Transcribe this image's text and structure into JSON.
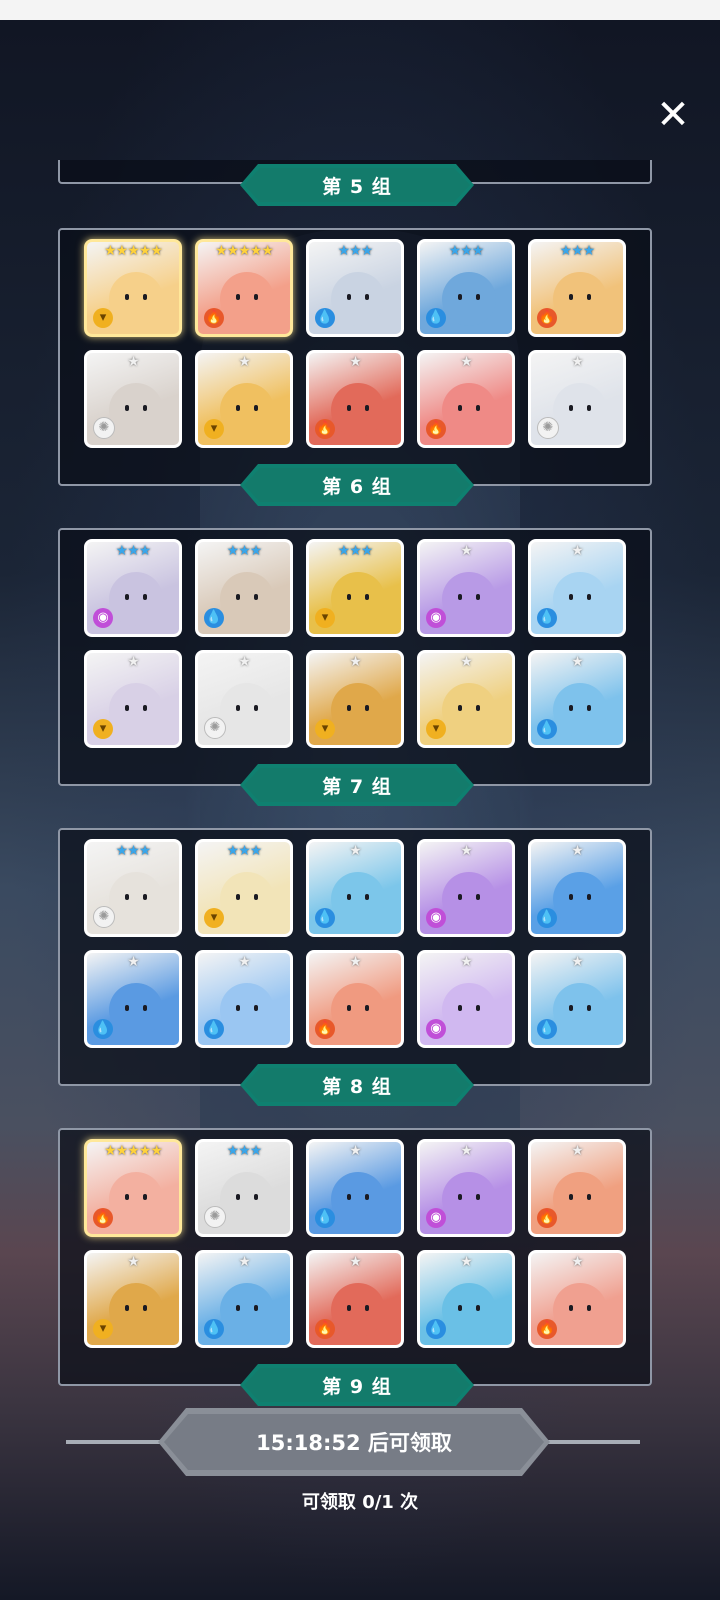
{
  "close_icon": "✕",
  "groups": [
    {
      "banner": "第 5 组",
      "heroes": [
        {
          "stars": "★★★★★",
          "star_color": "gold",
          "element": "wind",
          "bg": "#f6d08a"
        },
        {
          "stars": "★★★★★",
          "star_color": "gold",
          "element": "fire",
          "bg": "#f3a08a"
        },
        {
          "stars": "★★★",
          "star_color": "blue",
          "element": "water",
          "bg": "#c9d3e2"
        },
        {
          "stars": "★★★",
          "star_color": "blue",
          "element": "water",
          "bg": "#6fa8dc"
        },
        {
          "stars": "★★★",
          "star_color": "blue",
          "element": "fire",
          "bg": "#f1c27a"
        },
        {
          "stars": "★",
          "star_color": "gray",
          "element": "light",
          "bg": "#d9d2cc"
        },
        {
          "stars": "★",
          "star_color": "gray",
          "element": "wind",
          "bg": "#f0c060"
        },
        {
          "stars": "★",
          "star_color": "gray",
          "element": "fire",
          "bg": "#e26a5a"
        },
        {
          "stars": "★",
          "star_color": "gray",
          "element": "fire",
          "bg": "#ef8a86"
        },
        {
          "stars": "★",
          "star_color": "gray",
          "element": "light",
          "bg": "#dfe3ea"
        }
      ]
    },
    {
      "banner": "第 6 组",
      "heroes": [
        {
          "stars": "★★★",
          "star_color": "blue",
          "element": "dark",
          "bg": "#c9c3e0"
        },
        {
          "stars": "★★★",
          "star_color": "blue",
          "element": "water",
          "bg": "#d9c9b8"
        },
        {
          "stars": "★★★",
          "star_color": "blue",
          "element": "wind",
          "bg": "#e8c04a"
        },
        {
          "stars": "★",
          "star_color": "gray",
          "element": "dark",
          "bg": "#b89ae6"
        },
        {
          "stars": "★",
          "star_color": "gray",
          "element": "water",
          "bg": "#a8d4f2"
        },
        {
          "stars": "★",
          "star_color": "gray",
          "element": "wind",
          "bg": "#d8d0e6"
        },
        {
          "stars": "★",
          "star_color": "gray",
          "element": "light",
          "bg": "#e6e6e6"
        },
        {
          "stars": "★",
          "star_color": "gray",
          "element": "wind",
          "bg": "#e0a84a"
        },
        {
          "stars": "★",
          "star_color": "gray",
          "element": "wind",
          "bg": "#efd080"
        },
        {
          "stars": "★",
          "star_color": "gray",
          "element": "water",
          "bg": "#7ec2ec"
        }
      ]
    },
    {
      "banner": "第 7 组",
      "heroes": [
        {
          "stars": "★★★",
          "star_color": "blue",
          "element": "light",
          "bg": "#e6e2dc"
        },
        {
          "stars": "★★★",
          "star_color": "blue",
          "element": "wind",
          "bg": "#f2e4b8"
        },
        {
          "stars": "★",
          "star_color": "gray",
          "element": "water",
          "bg": "#7cc6ea"
        },
        {
          "stars": "★",
          "star_color": "gray",
          "element": "dark",
          "bg": "#b690e6"
        },
        {
          "stars": "★",
          "star_color": "gray",
          "element": "water",
          "bg": "#5aa0e6"
        },
        {
          "stars": "★",
          "star_color": "gray",
          "element": "water",
          "bg": "#5a9ae2"
        },
        {
          "stars": "★",
          "star_color": "gray",
          "element": "water",
          "bg": "#9ac6f2"
        },
        {
          "stars": "★",
          "star_color": "gray",
          "element": "fire",
          "bg": "#f09a80"
        },
        {
          "stars": "★",
          "star_color": "gray",
          "element": "dark",
          "bg": "#d0b8f0"
        },
        {
          "stars": "★",
          "star_color": "gray",
          "element": "water",
          "bg": "#7ec2ec"
        }
      ]
    },
    {
      "banner": "第 8 组",
      "heroes": [
        {
          "stars": "★★★★★",
          "star_color": "gold",
          "element": "fire",
          "bg": "#f3b0a0"
        },
        {
          "stars": "★★★",
          "star_color": "blue",
          "element": "light",
          "bg": "#dcdcdc"
        },
        {
          "stars": "★",
          "star_color": "gray",
          "element": "water",
          "bg": "#5a9ae2"
        },
        {
          "stars": "★",
          "star_color": "gray",
          "element": "dark",
          "bg": "#b690e6"
        },
        {
          "stars": "★",
          "star_color": "gray",
          "element": "fire",
          "bg": "#f0a080"
        },
        {
          "stars": "★",
          "star_color": "gray",
          "element": "wind",
          "bg": "#e0a84a"
        },
        {
          "stars": "★",
          "star_color": "gray",
          "element": "water",
          "bg": "#6ab0e6"
        },
        {
          "stars": "★",
          "star_color": "gray",
          "element": "fire",
          "bg": "#e26a5a"
        },
        {
          "stars": "★",
          "star_color": "gray",
          "element": "water",
          "bg": "#6ac0e6"
        },
        {
          "stars": "★",
          "star_color": "gray",
          "element": "fire",
          "bg": "#f0a090"
        }
      ]
    },
    {
      "banner": "第 9 组",
      "heroes": []
    }
  ],
  "element_glyphs": {
    "water": "💧",
    "fire": "🔥",
    "wind": "▾",
    "light": "✺",
    "dark": "◉"
  },
  "claim_button": "15:18:52 后可领取",
  "claim_count": "可领取 0/1 次"
}
